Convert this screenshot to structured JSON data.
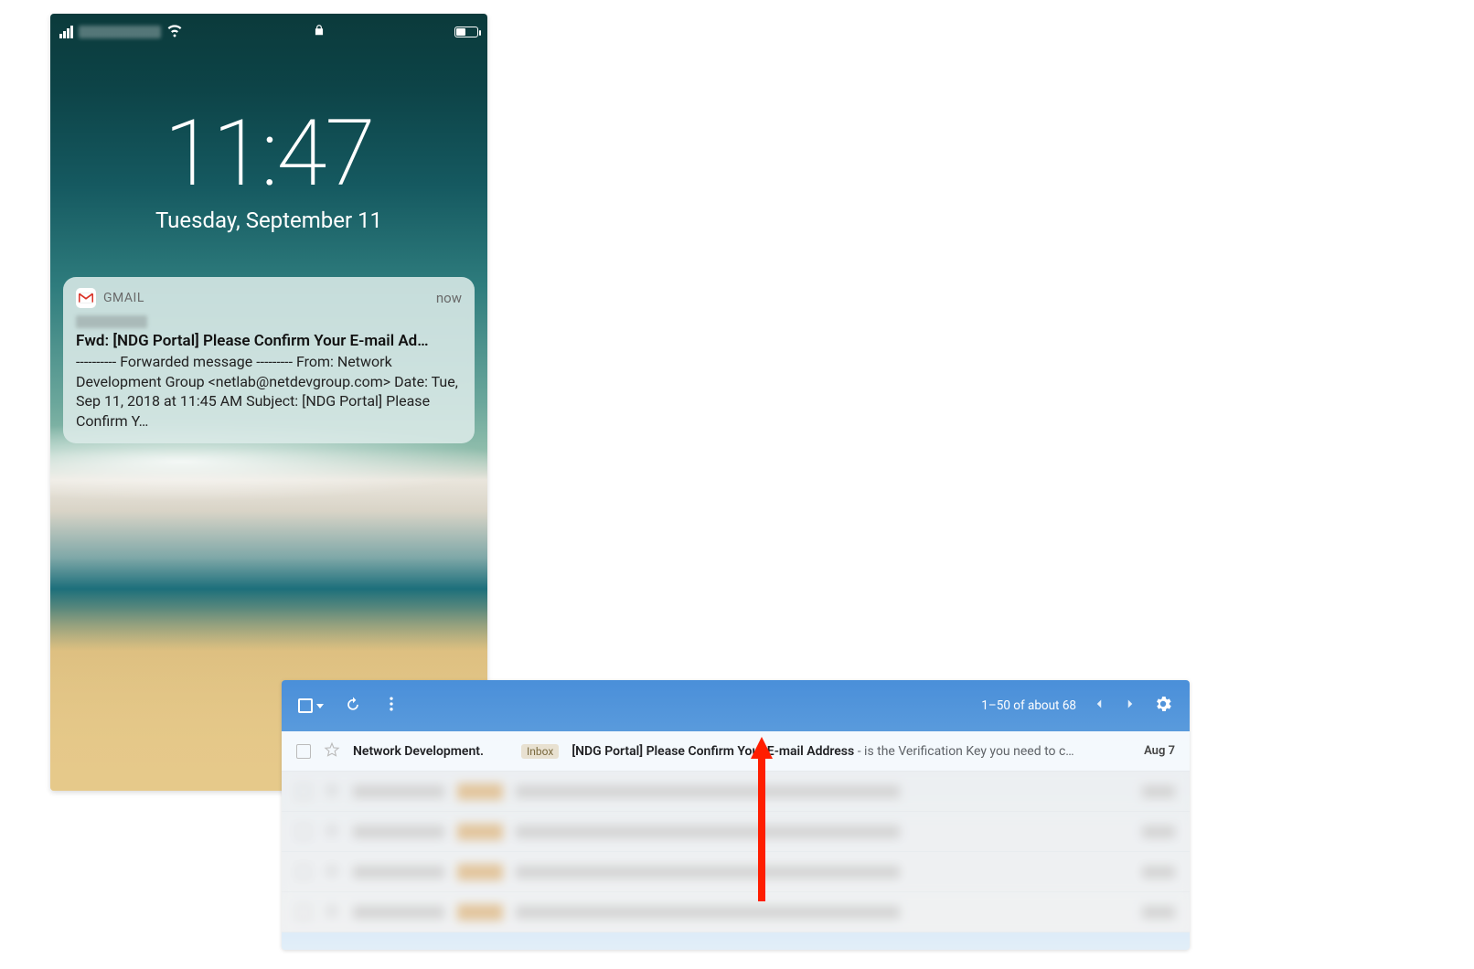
{
  "phone": {
    "status": {
      "signal_bars": 4,
      "wifi": true,
      "locked": true,
      "battery_percent": 40
    },
    "clock": {
      "time": "11:47",
      "date": "Tuesday, September 11"
    },
    "notification": {
      "app": "GMAIL",
      "timestamp": "now",
      "title": "Fwd: [NDG Portal] Please Confirm Your E-mail Ad…",
      "body": "---------- Forwarded message --------- From: Network Development Group <netlab@netdevgroup.com> Date: Tue, Sep 11, 2018 at 11:45 AM Subject: [NDG Portal] Please Confirm Y…"
    }
  },
  "gmail": {
    "toolbar": {
      "pagination": "1–50 of about 68"
    },
    "row": {
      "sender": "Network Development.",
      "inbox_label": "Inbox",
      "subject": "[NDG Portal] Please Confirm Your E-mail Address",
      "snippet": " - is the Verification Key you need to c…",
      "date": "Aug 7"
    }
  }
}
